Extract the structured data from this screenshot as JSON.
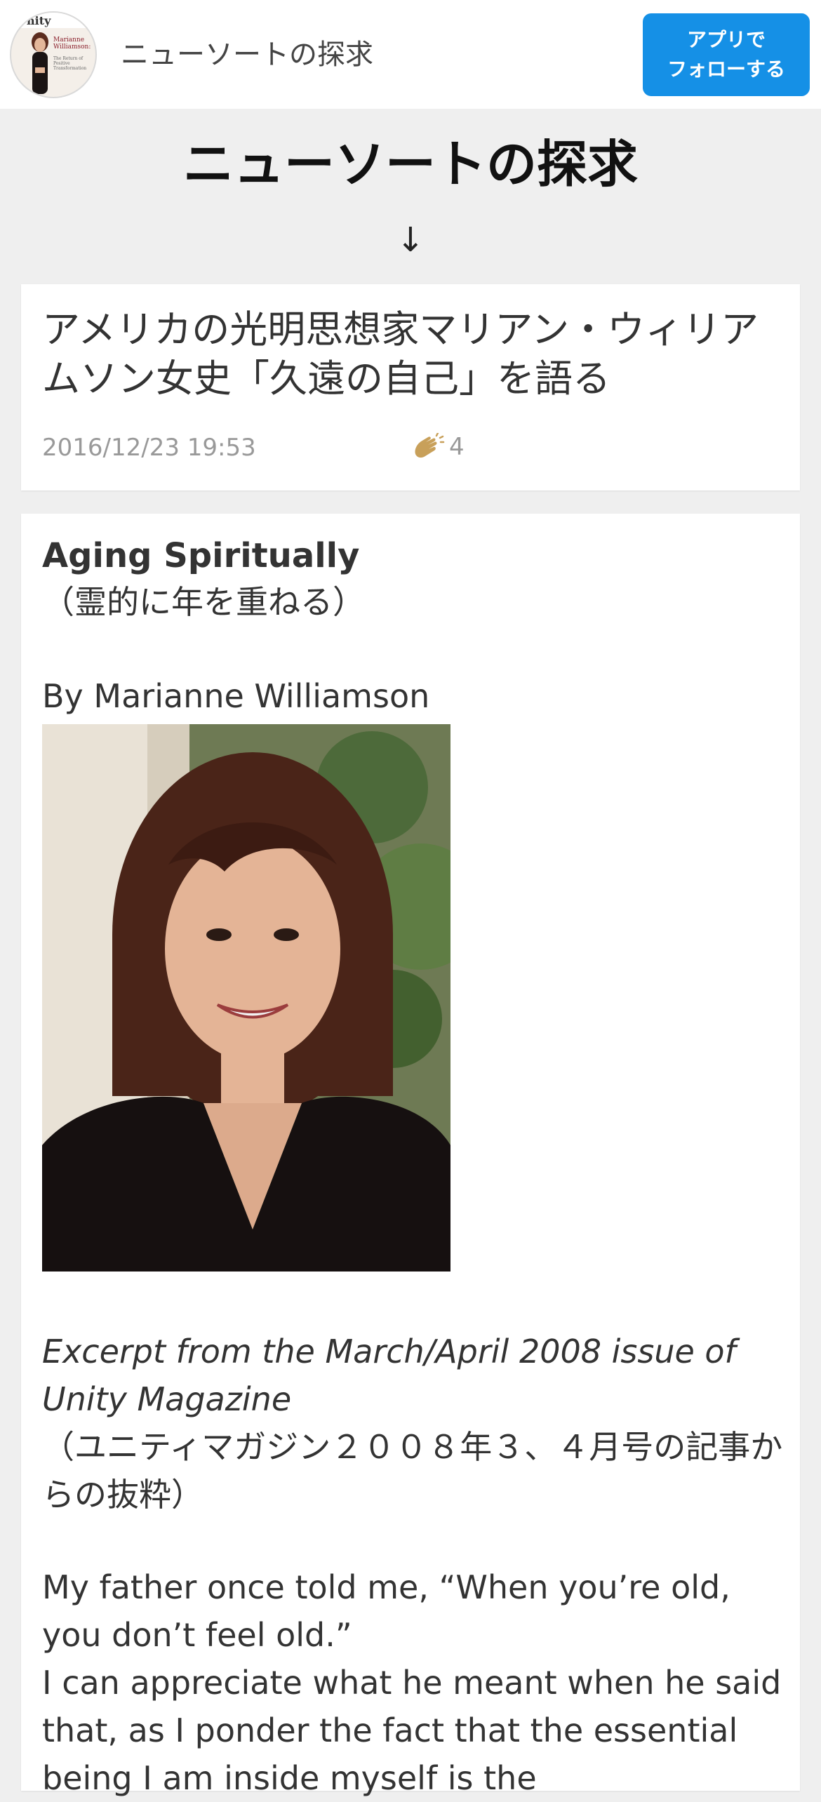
{
  "topbar": {
    "blog_name": "ニューソートの探求",
    "follow_button": "アプリで\nフォローする",
    "avatar": {
      "logo": "nity",
      "title": "Marianne Williamson:",
      "subtitle": "The Return of Positive Transformation"
    }
  },
  "header": {
    "title": "ニューソートの探求",
    "arrow": "↓"
  },
  "article": {
    "title": "アメリカの光明思想家マリアン・ウィリアムソン女史「久遠の自己」を語る",
    "date": "2016/12/23 19:53",
    "likes": "4",
    "like_icon": "clap-icon"
  },
  "body": {
    "heading": "Aging Spiritually",
    "heading_ja": "（霊的に年を重ねる）",
    "byline": "By Marianne Williamson",
    "excerpt": "Excerpt from the March/April 2008 issue of Unity Magazine",
    "excerpt_ja": "（ユニティマガジン２００８年３、４月号の記事からの抜粋）",
    "para1": "My father once told me, “When you’re old, you don’t feel old.”",
    "para2": "I can appreciate what he meant when he said that, as I ponder the fact that the essential being I am inside myself is the"
  },
  "colors": {
    "accent": "#1590e6",
    "background": "#efefef",
    "card": "#ffffff",
    "clap": "#c8a05a"
  }
}
